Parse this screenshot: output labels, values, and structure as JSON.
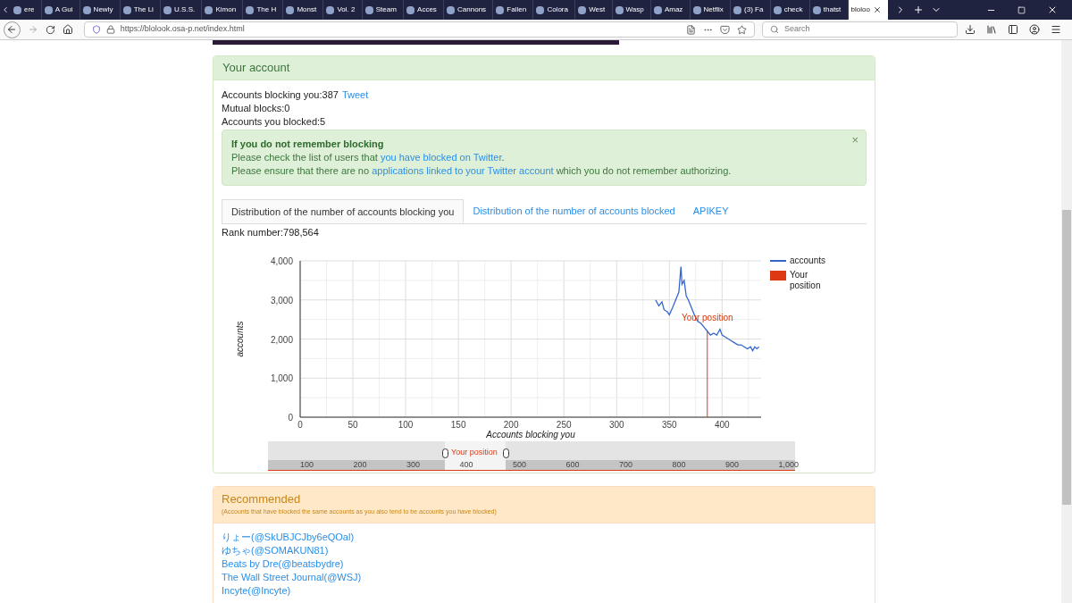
{
  "browser": {
    "tabs": [
      {
        "title": "ere",
        "selected": false
      },
      {
        "title": "A Gui",
        "selected": false
      },
      {
        "title": "Newly",
        "selected": false
      },
      {
        "title": "The Li",
        "selected": false
      },
      {
        "title": "U.S.S.",
        "selected": false
      },
      {
        "title": "Kimon",
        "selected": false
      },
      {
        "title": "The H",
        "selected": false
      },
      {
        "title": "Monst",
        "selected": false
      },
      {
        "title": "Vol. 2",
        "selected": false
      },
      {
        "title": "Steam",
        "selected": false
      },
      {
        "title": "Acces",
        "selected": false
      },
      {
        "title": "Cannons",
        "selected": false
      },
      {
        "title": "Fallen",
        "selected": false
      },
      {
        "title": "Colora",
        "selected": false
      },
      {
        "title": "West",
        "selected": false
      },
      {
        "title": "Wasp",
        "selected": false
      },
      {
        "title": "Amaz",
        "selected": false
      },
      {
        "title": "Netflix",
        "selected": false
      },
      {
        "title": "(3) Fa",
        "selected": false
      },
      {
        "title": "check",
        "selected": false
      },
      {
        "title": "thatst",
        "selected": false
      },
      {
        "title": "bloloo",
        "selected": true
      }
    ],
    "url": "https://blolook.osa-p.net/index.html",
    "search_placeholder": "Search"
  },
  "account_panel": {
    "title": "Your account",
    "stats": [
      {
        "label": "Accounts blocking you:387",
        "link": "Tweet"
      },
      {
        "label": "Mutual blocks:0"
      },
      {
        "label": "Accounts you blocked:5"
      }
    ],
    "alert": {
      "title": "If you do not remember blocking",
      "close": "×",
      "lines": [
        [
          "Please check the list of users that ",
          "you have blocked on Twitter",
          "."
        ],
        [
          "Please ensure that there are no ",
          "applications linked to your Twitter account",
          " which you do not remember authorizing."
        ]
      ]
    },
    "tabs": [
      {
        "label": "Distribution of the number of accounts blocking you",
        "selected": true
      },
      {
        "label": "Distribution of the number of accounts blocked",
        "selected": false
      },
      {
        "label": "APIKEY",
        "selected": false
      }
    ],
    "rank": "Rank number:798,564",
    "chart_legend": [
      {
        "label": "Your position",
        "kind": "swatch"
      }
    ],
    "chart_data": {
      "type": "line",
      "grid": true,
      "xlabel": "Accounts blocking you",
      "ylabel": "accounts",
      "xlim": [
        0,
        437
      ],
      "ylim": [
        0,
        4000
      ],
      "xticks": [
        0,
        50,
        100,
        150,
        200,
        250,
        300,
        350,
        400
      ],
      "yticks": [
        {
          "value": 0,
          "label": "0"
        },
        {
          "value": 1000,
          "label": "1,000"
        },
        {
          "value": 2000,
          "label": "2,000"
        },
        {
          "value": 3000,
          "label": "3,000"
        },
        {
          "value": 4000,
          "label": "4,000"
        }
      ],
      "x": [
        337,
        340,
        343,
        345,
        348,
        350,
        353,
        356,
        359,
        361,
        362,
        364,
        366,
        368,
        371,
        374,
        377,
        380,
        383,
        386,
        389,
        392,
        395,
        398,
        400,
        403,
        406,
        409,
        412,
        415,
        418,
        421,
        424,
        427,
        429,
        431,
        433,
        435
      ],
      "series": [
        {
          "name": "accounts",
          "color": "#3366cc",
          "values": [
            3000,
            2850,
            2950,
            2750,
            2700,
            2620,
            2800,
            3000,
            3200,
            3850,
            3400,
            3500,
            3100,
            3000,
            2800,
            2600,
            2450,
            2400,
            2300,
            2200,
            2100,
            2150,
            2100,
            2250,
            2100,
            2050,
            2000,
            1950,
            1900,
            1850,
            1850,
            1800,
            1750,
            1800,
            1700,
            1800,
            1750,
            1800
          ]
        }
      ],
      "annotations": [
        {
          "x": 386,
          "y": 2200,
          "text": "Your position"
        }
      ]
    },
    "navigator": {
      "labels": [
        "100",
        "200",
        "300",
        "400",
        "500",
        "600",
        "700",
        "800",
        "900",
        "1,000"
      ],
      "marker": "Your position"
    }
  },
  "recommended": {
    "title": "Recommended",
    "subtitle": "(Accounts that have blocked the same accounts as you also tend to be accounts you have blocked)",
    "accounts": [
      "りょー(@SkUBJCJby6eQOal)",
      "ゆちゃ(@SOMAKUN81)",
      "Beats by Dre(@beatsbydre)",
      "The Wall Street Journal(@WSJ)",
      "Incyte(@Incyte)"
    ]
  }
}
